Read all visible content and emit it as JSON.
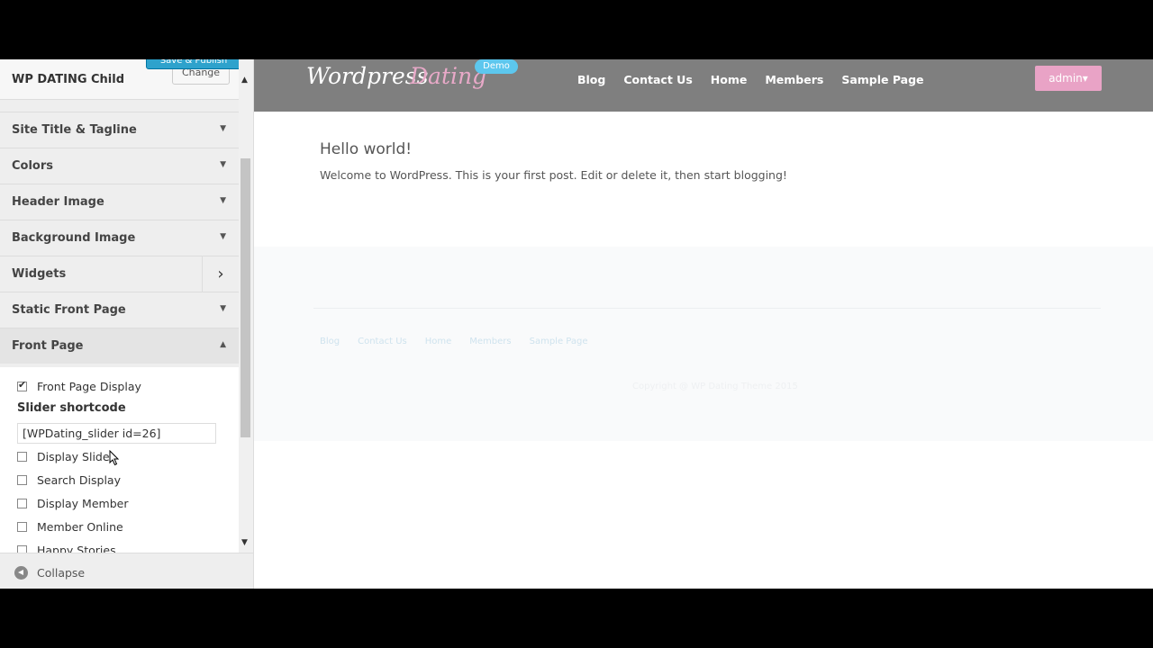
{
  "customizer": {
    "save_label": "Save & Publish",
    "theme_name": "WP DATING Child",
    "change_label": "Change",
    "sections": [
      {
        "label": "Site Title & Tagline"
      },
      {
        "label": "Colors"
      },
      {
        "label": "Header Image"
      },
      {
        "label": "Background Image"
      },
      {
        "label": "Widgets"
      },
      {
        "label": "Static Front Page"
      },
      {
        "label": "Front Page"
      }
    ],
    "front_page": {
      "display_label": "Front Page Display",
      "display_checked": true,
      "slider_title": "Slider shortcode",
      "slider_value": "[WPDating_slider id=26]",
      "options": [
        {
          "label": "Display Slider",
          "checked": false
        },
        {
          "label": "Search Display",
          "checked": false
        },
        {
          "label": "Display Member",
          "checked": false
        },
        {
          "label": "Member Online",
          "checked": false
        },
        {
          "label": "Happy Stories",
          "checked": false
        }
      ]
    },
    "collapse_label": "Collapse"
  },
  "site": {
    "logo_main": "Wordpress",
    "logo_accent": "Dating",
    "demo_badge": "Demo",
    "nav": [
      "Blog",
      "Contact Us",
      "Home",
      "Members",
      "Sample Page"
    ],
    "admin_label": "admin▾",
    "post_title": "Hello world!",
    "post_body": "Welcome to WordPress. This is your first post. Edit or delete it, then start blogging!",
    "footer_nav": [
      "Blog",
      "Contact Us",
      "Home",
      "Members",
      "Sample Page"
    ],
    "copyright": "Copyright @ WP Dating Theme 2015"
  },
  "colors": {
    "primary_button": "#2ea2cc",
    "header_bg": "#7f7f7f",
    "accent_pink": "#e9a3c6",
    "badge_blue": "#5dc7ee"
  }
}
